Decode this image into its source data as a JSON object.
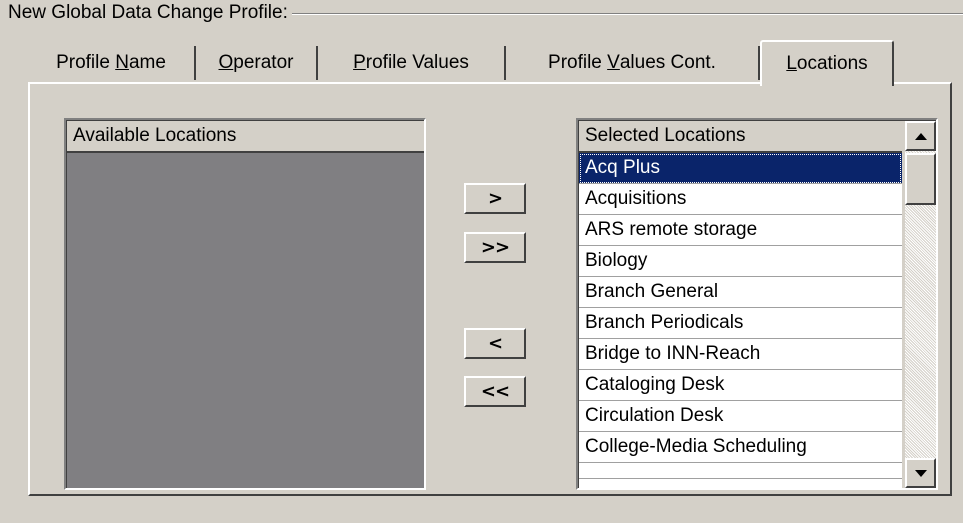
{
  "group": {
    "title": "New  Global Data Change Profile:"
  },
  "tabs": [
    {
      "pre": "Profile ",
      "accel": "N",
      "post": "ame"
    },
    {
      "pre": "",
      "accel": "O",
      "post": "perator"
    },
    {
      "pre": "",
      "accel": "P",
      "post": "rofile Values"
    },
    {
      "pre": "Profile ",
      "accel": "V",
      "post": "alues Cont."
    },
    {
      "pre": "",
      "accel": "L",
      "post": "ocations"
    }
  ],
  "active_tab": "Locations",
  "available_list": {
    "header": "Available Locations"
  },
  "selected_list": {
    "header": "Selected Locations",
    "items": [
      "Acq Plus",
      "Acquisitions",
      "ARS remote storage",
      "Biology",
      "Branch General",
      "Branch Periodicals",
      "Bridge to INN-Reach",
      "Cataloging Desk",
      "Circulation Desk",
      "College-Media Scheduling"
    ],
    "selected_item": "Acq Plus"
  },
  "buttons": {
    "add_one": ">",
    "add_all": ">>",
    "remove_one": "<",
    "remove_all": "<<"
  },
  "colors": {
    "window_bg": "#d4d0c8",
    "available_list_bg": "#807f82",
    "selection_bg": "#0a246a",
    "selection_text": "#ffffff"
  },
  "icons": {
    "scroll_up": "triangle-up-icon",
    "scroll_down": "triangle-down-icon"
  }
}
